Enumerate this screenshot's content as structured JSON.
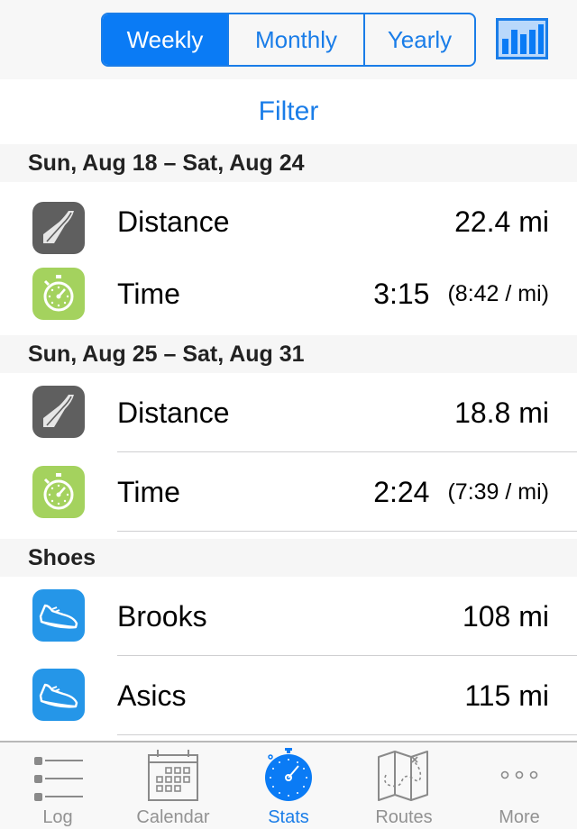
{
  "header": {
    "segments": [
      "Weekly",
      "Monthly",
      "Yearly"
    ],
    "selected_segment": "Weekly",
    "chart_button_icon": "bar-chart-icon"
  },
  "filter_label": "Filter",
  "weeks": [
    {
      "range": "Sun, Aug 18 – Sat, Aug 24",
      "distance_label": "Distance",
      "distance_value": "22.4 mi",
      "time_label": "Time",
      "time_value": "3:15",
      "pace": "(8:42 / mi)"
    },
    {
      "range": "Sun, Aug 25 – Sat, Aug 31",
      "distance_label": "Distance",
      "distance_value": "18.8 mi",
      "time_label": "Time",
      "time_value": "2:24",
      "pace": "(7:39 / mi)"
    }
  ],
  "shoes": {
    "title": "Shoes",
    "items": [
      {
        "name": "Brooks",
        "value": "108 mi"
      },
      {
        "name": "Asics",
        "value": "115 mi"
      }
    ]
  },
  "tabbar": {
    "tabs": [
      {
        "label": "Log",
        "icon": "list-icon"
      },
      {
        "label": "Calendar",
        "icon": "calendar-icon"
      },
      {
        "label": "Stats",
        "icon": "stopwatch-icon"
      },
      {
        "label": "Routes",
        "icon": "map-icon"
      },
      {
        "label": "More",
        "icon": "more-icon"
      }
    ],
    "active": "Stats"
  },
  "colors": {
    "accent": "#1a7de8",
    "road_icon_bg": "#5f5f5f",
    "time_icon_bg": "#a4d25e",
    "shoe_icon_bg": "#2596e8"
  }
}
